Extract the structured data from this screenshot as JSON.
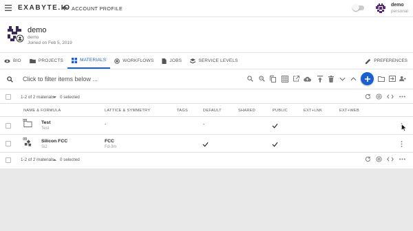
{
  "header": {
    "brand": "EXABYTE.IO",
    "title": "ACCOUNT PROFILE",
    "user_name": "demo",
    "user_role": "personal"
  },
  "profile": {
    "name": "demo",
    "handle": "demo",
    "joined": "Joined on Feb 5, 2019"
  },
  "tabs": [
    {
      "label": "BIO",
      "icon": "eye-icon"
    },
    {
      "label": "PROJECTS",
      "icon": "folder-icon"
    },
    {
      "label": "MATERIALS",
      "icon": "grid-icon"
    },
    {
      "label": "WORKFLOWS",
      "icon": "radio-icon"
    },
    {
      "label": "JOBS",
      "icon": "file-icon"
    },
    {
      "label": "SERVICE LEVELS",
      "icon": "layers-icon"
    }
  ],
  "preferences_label": "PREFERENCES",
  "search": {
    "placeholder": "Click to filter items below ..."
  },
  "pagination": {
    "range": "1-2 of 2 materials",
    "selected": "0 selected"
  },
  "columns": [
    "NAME & FORMULA",
    "LATTICE & SYMMETRY",
    "TAGS",
    "DEFAULT",
    "SHARED",
    "PUBLIC",
    "EXT+LNK",
    "EXT+WEB"
  ],
  "rows": [
    {
      "name": "Test",
      "formula": "Test",
      "lattice": "-",
      "symmetry": "",
      "default": "-",
      "default_check": false,
      "public": true
    },
    {
      "name": "Silicon FCC",
      "formula": "Si2",
      "lattice": "FCC",
      "symmetry": "Fd-3m",
      "default": "",
      "default_check": true,
      "public": true
    }
  ],
  "colors": {
    "accent": "#1a5fd0"
  }
}
